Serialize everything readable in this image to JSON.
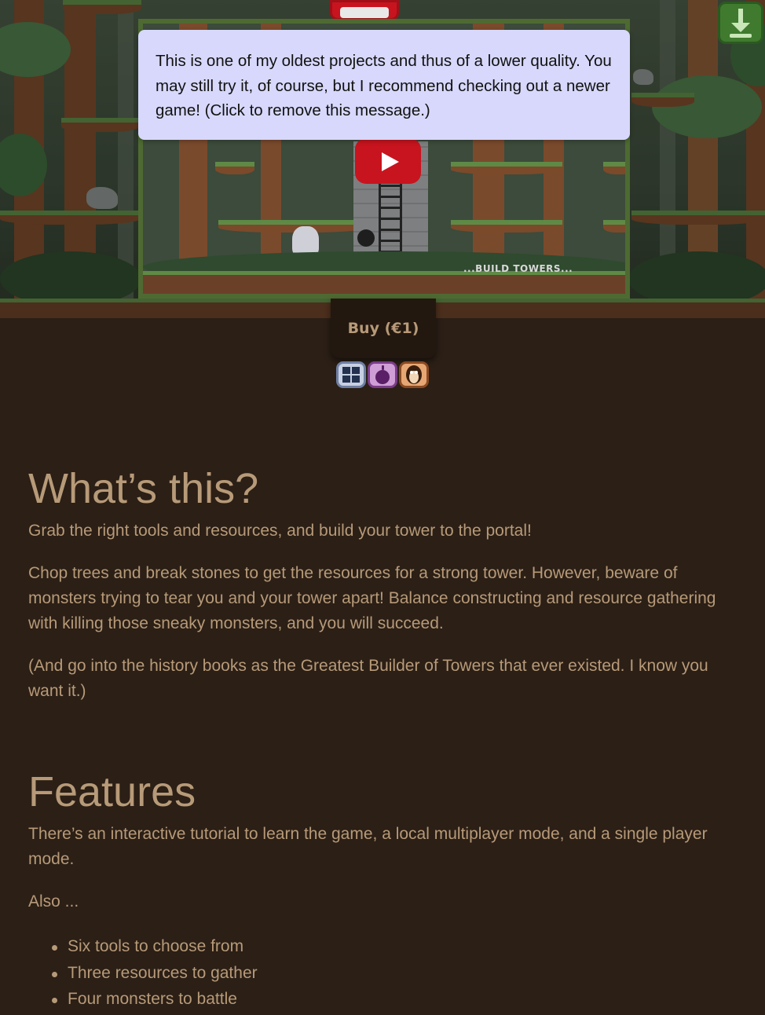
{
  "notice": {
    "text": "This is one of my oldest projects and thus of a lower quality. You may still try it, of course, but I recommend checking out a newer game! (Click to remove this message.)"
  },
  "video": {
    "caption": "...BUILD TOWERS..."
  },
  "buy": {
    "label": "Buy (€1)"
  },
  "platforms": [
    {
      "name": "Windows",
      "icon": "windows-icon"
    },
    {
      "name": "macOS",
      "icon": "apple-icon"
    },
    {
      "name": "Linux",
      "icon": "linux-penguin-icon"
    }
  ],
  "about": {
    "heading": "What’s this?",
    "p1": "Grab the right tools and resources, and build your tower to the portal!",
    "p2": "Chop trees and break stones to get the resources for a strong tower. However, beware of monsters trying to tear you and your tower apart! Balance constructing and resource gathering with killing those sneaky monsters, and you will succeed.",
    "p3": "(And go into the history books as the Greatest Builder of Towers that ever existed. I know you want it.)"
  },
  "features": {
    "heading": "Features",
    "p1": "There’s an interactive tutorial to learn the game, a local multiplayer mode, and a single player mode.",
    "p2": "Also ...",
    "items": [
      "Six tools to choose from",
      "Three resources to gather",
      "Four monsters to battle"
    ]
  },
  "colors": {
    "background": "#2b1f16",
    "text": "#b79a78",
    "notice_bg": "#d7d8fb",
    "frame_green": "#4e6a32"
  }
}
